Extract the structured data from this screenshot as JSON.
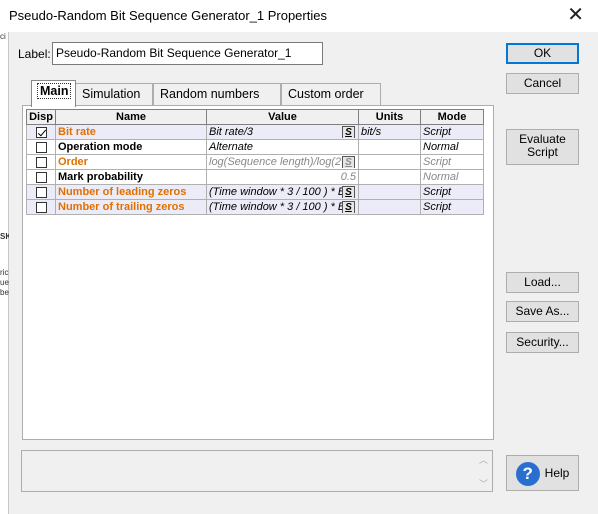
{
  "window": {
    "title": "Pseudo-Random Bit Sequence Generator_1 Properties"
  },
  "label_field": {
    "label": "Label:",
    "value": "Pseudo-Random Bit Sequence Generator_1"
  },
  "tabs": [
    "Main",
    "Simulation",
    "Random numbers",
    "Custom order"
  ],
  "active_tab": "Main",
  "table": {
    "headers": [
      "Disp",
      "Name",
      "Value",
      "Units",
      "Mode"
    ],
    "rows": [
      {
        "disp": true,
        "name": "Bit rate",
        "value": "Bit rate/3",
        "units": "bit/s",
        "mode": "Script",
        "name_color": "orange"
      },
      {
        "disp": false,
        "name": "Operation mode",
        "value": "Alternate",
        "units": "",
        "mode": "Normal",
        "name_color": "black"
      },
      {
        "disp": false,
        "name": "Order",
        "value": "log(Sequence length)/log(2",
        "units": "",
        "mode": "Script",
        "name_color": "orange",
        "disabled": true
      },
      {
        "disp": false,
        "name": "Mark probability",
        "value": "0.5",
        "units": "",
        "mode": "Normal",
        "name_color": "black",
        "disabled": true
      },
      {
        "disp": false,
        "name": "Number of leading zeros",
        "value": "(Time window * 3 / 100 ) * B",
        "units": "",
        "mode": "Script",
        "name_color": "orange"
      },
      {
        "disp": false,
        "name": "Number of trailing zeros",
        "value": "(Time window * 3 / 100 ) * B",
        "units": "",
        "mode": "Script",
        "name_color": "orange"
      }
    ],
    "script_button": "S"
  },
  "buttons": {
    "ok": "OK",
    "cancel": "Cancel",
    "evaluate_script_line1": "Evaluate",
    "evaluate_script_line2": "Script",
    "load": "Load...",
    "save_as": "Save As...",
    "security": "Security...",
    "help": "Help"
  },
  "colors": {
    "orange": "#e07000",
    "accent": "#0078d7"
  }
}
